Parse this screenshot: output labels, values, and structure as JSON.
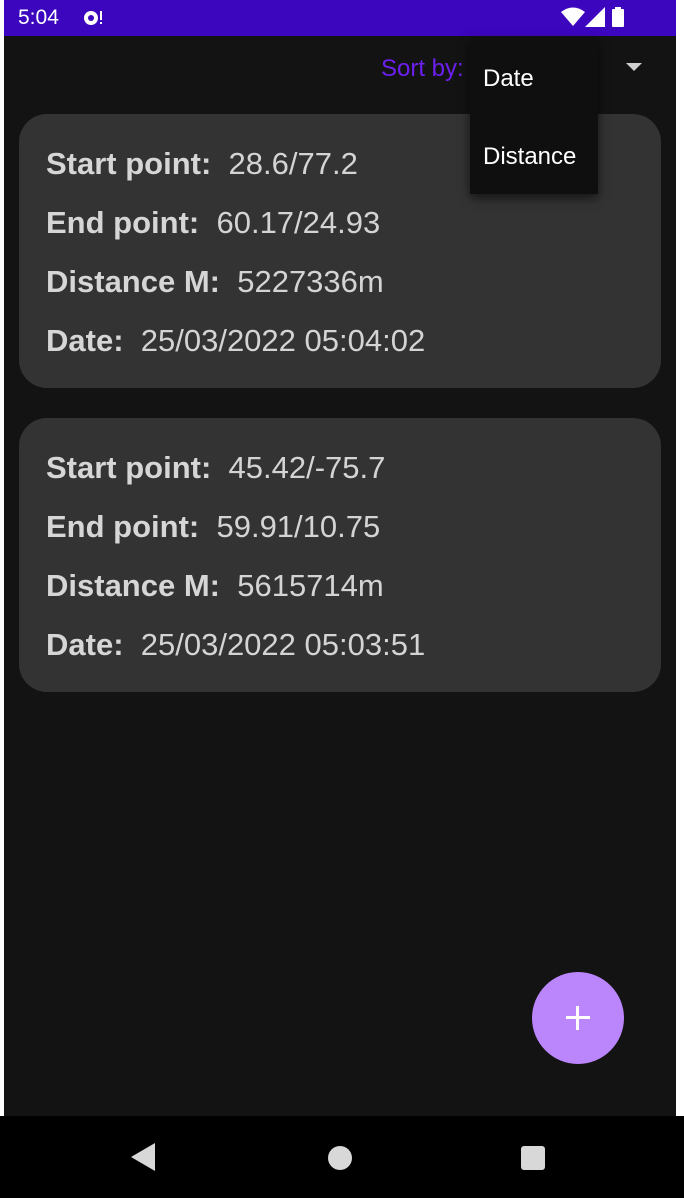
{
  "status_bar": {
    "time": "5:04",
    "icons": [
      "notification-icon",
      "wifi-icon",
      "signal-icon",
      "battery-icon"
    ]
  },
  "sort": {
    "label": "Sort by:",
    "options": [
      "Date",
      "Distance"
    ]
  },
  "cards": [
    {
      "start_label": "Start point:",
      "start_value": "28.6/77.2",
      "end_label": "End point:",
      "end_value": "60.17/24.93",
      "distance_label": "Distance M:",
      "distance_value": "5227336m",
      "date_label": "Date:",
      "date_value": "25/03/2022 05:04:02"
    },
    {
      "start_label": "Start point:",
      "start_value": "45.42/-75.7",
      "end_label": "End point:",
      "end_value": "59.91/10.75",
      "distance_label": "Distance M:",
      "distance_value": "5615714m",
      "date_label": "Date:",
      "date_value": "25/03/2022 05:03:51"
    }
  ],
  "fab": {
    "icon": "plus-icon"
  },
  "nav": {
    "icons": [
      "back-icon",
      "home-icon",
      "recents-icon"
    ]
  },
  "colors": {
    "status_bar": "#3c05be",
    "background": "#131313",
    "card": "#333333",
    "sort_label": "#6d1ff0",
    "fab": "#bb86fc"
  }
}
